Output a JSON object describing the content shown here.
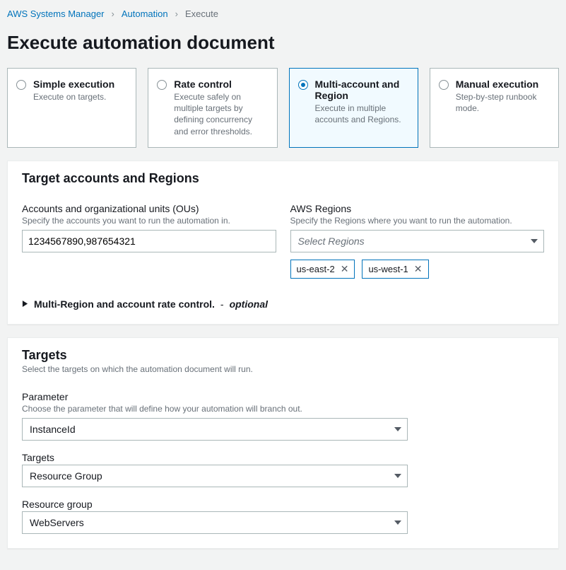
{
  "breadcrumb": {
    "root": "AWS Systems Manager",
    "mid": "Automation",
    "current": "Execute"
  },
  "page_title": "Execute automation document",
  "tiles": [
    {
      "title": "Simple execution",
      "desc": "Execute on targets."
    },
    {
      "title": "Rate control",
      "desc": "Execute safely on multiple targets by defining concurrency and error thresholds."
    },
    {
      "title": "Multi-account and Region",
      "desc": "Execute in multiple accounts and Regions."
    },
    {
      "title": "Manual execution",
      "desc": "Step-by-step runbook mode."
    }
  ],
  "selected_tile_index": 2,
  "accounts_panel": {
    "title": "Target accounts and Regions",
    "accounts_label": "Accounts and organizational units (OUs)",
    "accounts_desc": "Specify the accounts you want to run the automation in.",
    "accounts_value": "1234567890,987654321",
    "regions_label": "AWS Regions",
    "regions_desc": "Specify the Regions where you want to run the automation.",
    "regions_placeholder": "Select Regions",
    "region_tags": [
      "us-east-2",
      "us-west-1"
    ],
    "expander_label": "Multi-Region and account rate control.",
    "expander_dash": "-",
    "expander_optional": "optional"
  },
  "targets_panel": {
    "title": "Targets",
    "subtitle": "Select the targets on which the automation document will run.",
    "parameter_label": "Parameter",
    "parameter_desc": "Choose the parameter that will define how your automation will branch out.",
    "parameter_value": "InstanceId",
    "targets_label": "Targets",
    "targets_value": "Resource Group",
    "rg_label": "Resource group",
    "rg_value": "WebServers"
  }
}
